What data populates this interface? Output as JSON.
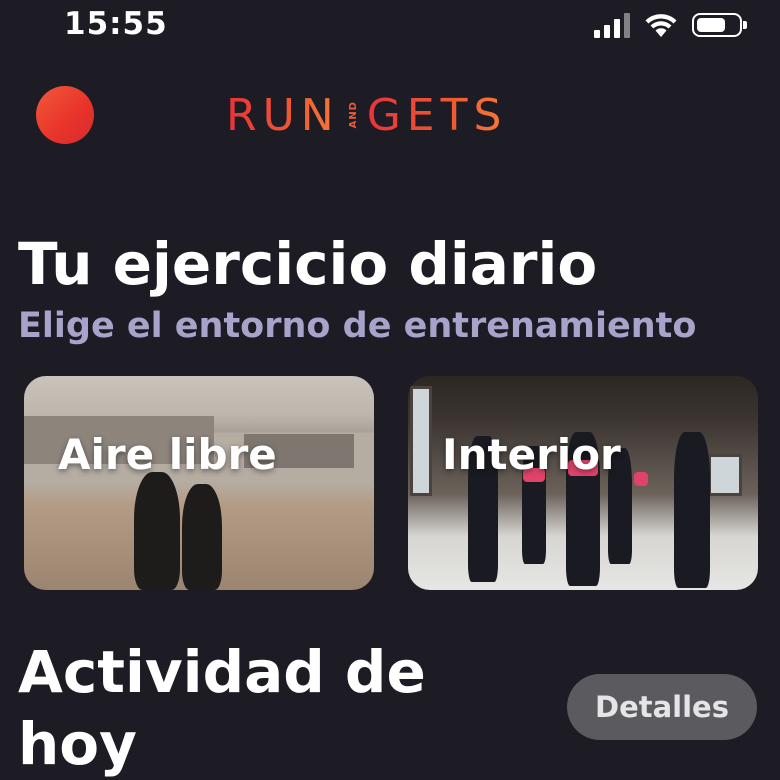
{
  "status_bar": {
    "time": "15:55",
    "icons": [
      "cellular-signal-icon",
      "wifi-icon",
      "battery-icon"
    ]
  },
  "header": {
    "logo": {
      "word1": "RUN",
      "connector": "AND",
      "word2": "GETS"
    },
    "logo_colors": [
      "#e8333a",
      "#f5793a"
    ]
  },
  "daily_exercise": {
    "title": "Tu ejercicio diario",
    "subtitle": "Elige el entorno de entrenamiento",
    "cards": [
      {
        "label": "Aire libre"
      },
      {
        "label": "Interior"
      }
    ]
  },
  "activity": {
    "title_line1": "Actividad de",
    "title_line2": "hoy",
    "details_label": "Detalles"
  },
  "colors": {
    "background": "#1d1b24",
    "subtitle": "#a7a3cb",
    "button": "#5b5a5f"
  }
}
